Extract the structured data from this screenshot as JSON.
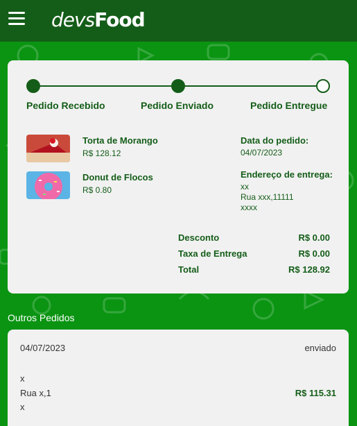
{
  "header": {
    "logo_text_a": "devs",
    "logo_text_b": "Food",
    "menu_icon": "hamburger-icon",
    "bar_color": "#145d18",
    "bg_color": "#0a9412"
  },
  "tracker": {
    "steps": [
      "Pedido Recebido",
      "Pedido Enviado",
      "Pedido Entregue"
    ],
    "completed_steps": 2
  },
  "items": [
    {
      "name": "Torta de Morango",
      "price": "R$ 128.12",
      "image": "strawberry-pie-image"
    },
    {
      "name": "Donut de Flocos",
      "price": "R$ 0.80",
      "image": "sprinkle-donut-image"
    }
  ],
  "order_info": {
    "date_label": "Data do pedido:",
    "date_value": "04/07/2023",
    "address_label": "Endereço de entrega:",
    "address_lines": [
      "xx",
      "Rua xxx,11111",
      "xxxx"
    ]
  },
  "summary": {
    "discount_label": "Desconto",
    "discount_value": "R$ 0.00",
    "delivery_label": "Taxa de Entrega",
    "delivery_value": "R$ 0.00",
    "total_label": "Total",
    "total_value": "R$ 128.92"
  },
  "other_orders": {
    "title": "Outros Pedidos",
    "orders": [
      {
        "date": "04/07/2023",
        "status": "enviado",
        "address_lines": [
          "x",
          "Rua x,1",
          "x"
        ],
        "total": "R$ 115.31"
      }
    ]
  }
}
